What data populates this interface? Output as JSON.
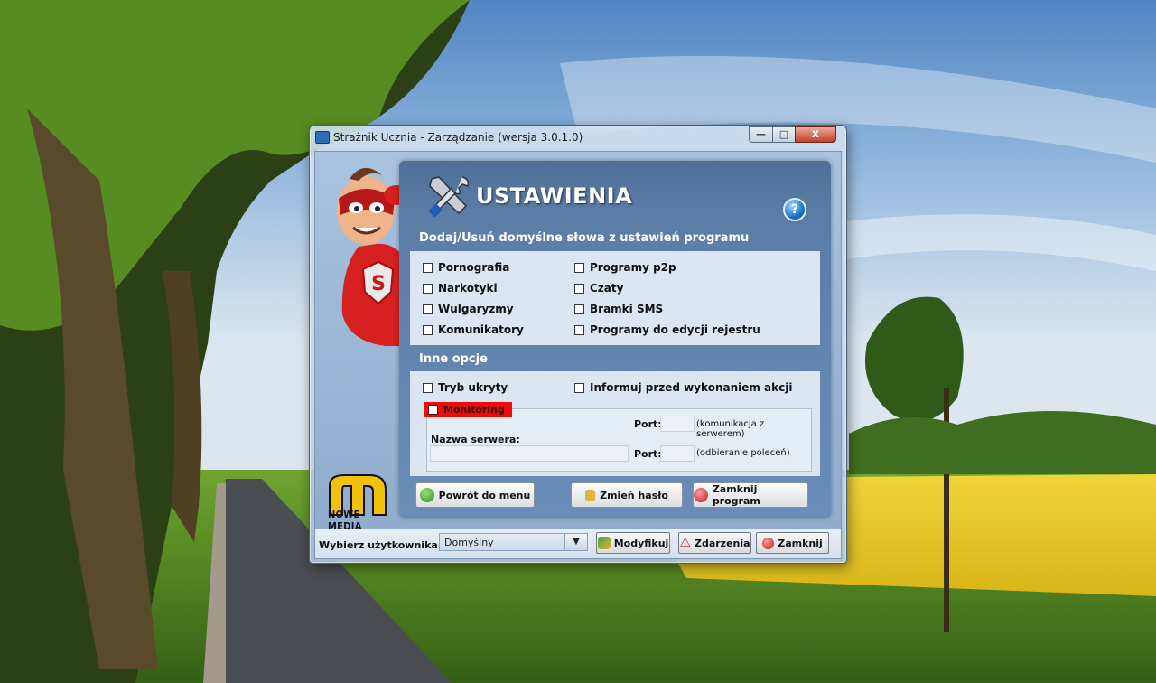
{
  "window": {
    "title": "Strażnik Ucznia - Zarządzanie (wersja 3.0.1.0)",
    "controls": {
      "minimize": "—",
      "maximize": "□",
      "close": "x"
    }
  },
  "branding": {
    "logo_text": "NOWE MEDIA"
  },
  "header": {
    "title": "USTAWIENIA",
    "help_label": "?"
  },
  "filters": {
    "section_title": "Dodaj/Usuń domyślne słowa z ustawień programu",
    "left": [
      "Pornografia",
      "Narkotyki",
      "Wulgaryzmy",
      "Komunikatory"
    ],
    "right": [
      "Programy p2p",
      "Czaty",
      "Bramki SMS",
      "Programy do edycji rejestru"
    ]
  },
  "other_options": {
    "section_title": "Inne opcje",
    "hidden_mode": "Tryb ukryty",
    "inform_before": "Informuj przed wykonaniem akcji",
    "monitoring": "Monitoring",
    "port_label": "Port:",
    "port1_note": "(komunikacja z serwerem)",
    "server_name_label": "Nazwa serwera:",
    "port2_note": "(odbieranie poleceń)"
  },
  "actions": {
    "back": "Powrót do menu",
    "change_password": "Zmień hasło",
    "close_program": "Zamknij program"
  },
  "bottom": {
    "user_label": "Wybierz użytkownika:",
    "user_selected": "Domyślny",
    "modify": "Modyfikuj",
    "events": "Zdarzenia",
    "close": "Zamknij"
  }
}
